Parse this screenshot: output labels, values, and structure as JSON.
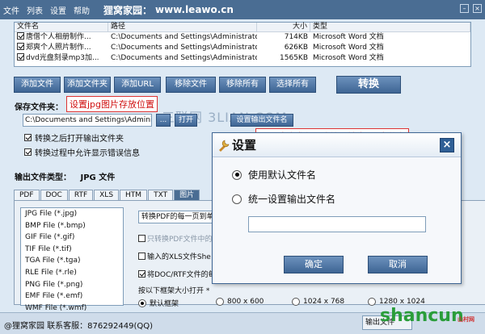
{
  "menubar": {
    "items": [
      "文件",
      "列表",
      "设置",
      "帮助"
    ],
    "brand": "狸窝家园：",
    "url": "www.leawo.cn"
  },
  "file_table": {
    "headers": [
      "文件名",
      "路径",
      "大小",
      "类型"
    ],
    "rows": [
      {
        "name": "唐僧个人相册制作...",
        "path": "C:\\Documents and Settings\\Administrator\\...",
        "size": "714KB",
        "type": "Microsoft Word 文档",
        "checked": true
      },
      {
        "name": "郑爽个人照片制作...",
        "path": "C:\\Documents and Settings\\Administrator\\...",
        "size": "626KB",
        "type": "Microsoft Word 文档",
        "checked": true
      },
      {
        "name": "dvd光盘刻录mp3加...",
        "path": "C:\\Documents and Settings\\Administrator\\...",
        "size": "1565KB",
        "type": "Microsoft Word 文档",
        "checked": true
      }
    ]
  },
  "actions": {
    "add_file": "添加文件",
    "add_folder": "添加文件夹",
    "add_url": "添加URL",
    "remove_file": "移除文件",
    "remove_all": "移除所有",
    "select_all": "选择所有",
    "convert": "转换"
  },
  "save": {
    "label": "保存文件夹：",
    "path": "C:\\Documents and Settings\\Administrator\\",
    "browse": "...",
    "open": "打开",
    "set_output_name": "设置输出文件名",
    "open_after": "转换之后打开输出文件夹",
    "show_errors": "转换过程中允许显示错误信息"
  },
  "annotations": {
    "save_location": "设置jpg图片存放位置",
    "output_name": "设置默认或者更改统一输出jpg文件名"
  },
  "watermark": "三联网 3LIAN.COM",
  "output": {
    "label": "输出文件类型：",
    "value": "JPG 文件"
  },
  "tabs": [
    "PDF",
    "DOC",
    "RTF",
    "XLS",
    "HTM",
    "TXT",
    "图片"
  ],
  "formats": [
    "JPG File (*.jpg)",
    "BMP File (*.bmp)",
    "GIF File (*.gif)",
    "TIF File (*.tif)",
    "TGA File (*.tga)",
    "RLE File (*.rle)",
    "PNG File (*.png)",
    "EMF File (*.emf)",
    "WMF File (*.wmf)"
  ],
  "panel": {
    "combo": "转换PDF的每一页到单",
    "only_pdf": "只转换PDF文件中的",
    "xls_sheet": "输入的XLS文件She",
    "doc_rtf": "将DOC/RTF文件的每",
    "frame_label": "按以下框架大小打开 *",
    "frames": [
      "默认框架",
      "800 x 600",
      "1024 x 768",
      "1280 x 1024"
    ]
  },
  "status": {
    "text": "@狸窝家园  联系客服：876292449(QQ)",
    "box": "输出文件"
  },
  "logo": {
    "text": "shancun",
    "small": "山村网"
  },
  "dialog": {
    "title": "设置",
    "close": "×",
    "option_default": "使用默认文件名",
    "option_unified": "统一设置输出文件名",
    "input_value": "",
    "ok": "确定",
    "cancel": "取消"
  }
}
